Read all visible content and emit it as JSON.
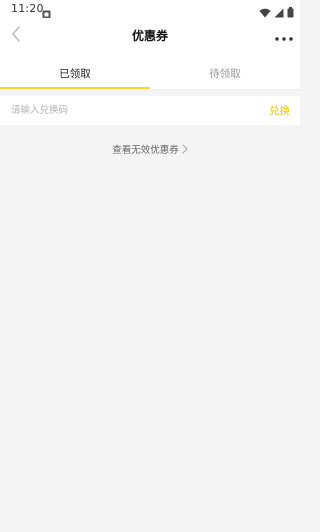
{
  "status_bar": {
    "time": "11:20",
    "icons": [
      "notification-icon",
      "wifi-icon",
      "signal-icon",
      "battery-icon"
    ]
  },
  "nav": {
    "title": "优惠券",
    "back_icon": "chevron-left-icon",
    "more_icon": "more-icon"
  },
  "tabs": [
    {
      "label": "已领取",
      "active": true
    },
    {
      "label": "待领取",
      "active": false
    }
  ],
  "redeem": {
    "placeholder": "请输入兑换码",
    "value": "",
    "button_label": "兑换"
  },
  "invalid_link": {
    "label": "查看无效优惠券",
    "icon": "chevron-right-icon"
  },
  "colors": {
    "accent": "#f6d32d",
    "redeem_text": "#f6c400",
    "background": "#f4f4f4",
    "surface": "#ffffff"
  }
}
